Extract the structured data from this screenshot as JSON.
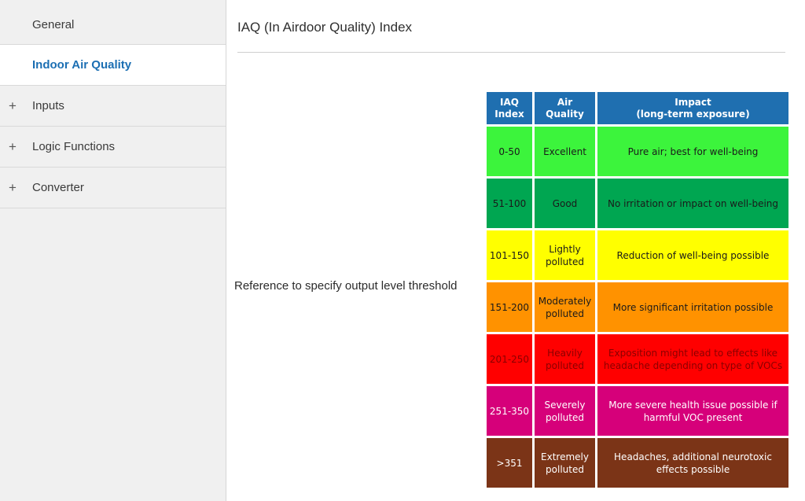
{
  "sidebar": {
    "items": [
      {
        "label": "General",
        "plus": "",
        "active": false
      },
      {
        "label": "Indoor Air Quality",
        "plus": "",
        "active": true
      },
      {
        "label": "Inputs",
        "plus": "+",
        "active": false
      },
      {
        "label": "Logic Functions",
        "plus": "+",
        "active": false
      },
      {
        "label": "Converter",
        "plus": "+",
        "active": false
      }
    ]
  },
  "main": {
    "title": "IAQ (In Airdoor Quality) Index",
    "ref_label": "Reference to specify output level threshold"
  },
  "iaq_table": {
    "headers": [
      {
        "line1": "IAQ",
        "line2": "Index"
      },
      {
        "line1": "Air",
        "line2": "Quality"
      },
      {
        "line1": "Impact",
        "line2": "(long-term exposure)"
      }
    ],
    "rows": [
      {
        "index": "0-50",
        "quality1": "Excellent",
        "quality2": "",
        "impact1": "Pure air; best for well-being",
        "impact2": "",
        "color": "#3cf43c",
        "text_color": "#1a1a1a"
      },
      {
        "index": "51-100",
        "quality1": "Good",
        "quality2": "",
        "impact1": "No irritation or impact on well-being",
        "impact2": "",
        "color": "#00a651",
        "text_color": "#1a1a1a"
      },
      {
        "index": "101-150",
        "quality1": "Lightly",
        "quality2": "polluted",
        "impact1": "Reduction of well-being possible",
        "impact2": "",
        "color": "#ffff00",
        "text_color": "#1a1a1a"
      },
      {
        "index": "151-200",
        "quality1": "Moderately",
        "quality2": "polluted",
        "impact1": "More significant irritation possible",
        "impact2": "",
        "color": "#ff9200",
        "text_color": "#1a1a1a"
      },
      {
        "index": "201-250",
        "quality1": "Heavily",
        "quality2": "polluted",
        "impact1": "Exposition might lead to effects like",
        "impact2": "headache depending on type of VOCs",
        "color": "#ff0000",
        "text_color": "#8a0000"
      },
      {
        "index": "251-350",
        "quality1": "Severely",
        "quality2": "polluted",
        "impact1": "More severe health issue possible if",
        "impact2": "harmful VOC present",
        "color": "#d6007a",
        "text_color": "#ffffff"
      },
      {
        "index": ">351",
        "quality1": "Extremely",
        "quality2": "polluted",
        "impact1": "Headaches, additional neurotoxic",
        "impact2": "effects possible",
        "color": "#7b3417",
        "text_color": "#ffffff"
      }
    ]
  }
}
